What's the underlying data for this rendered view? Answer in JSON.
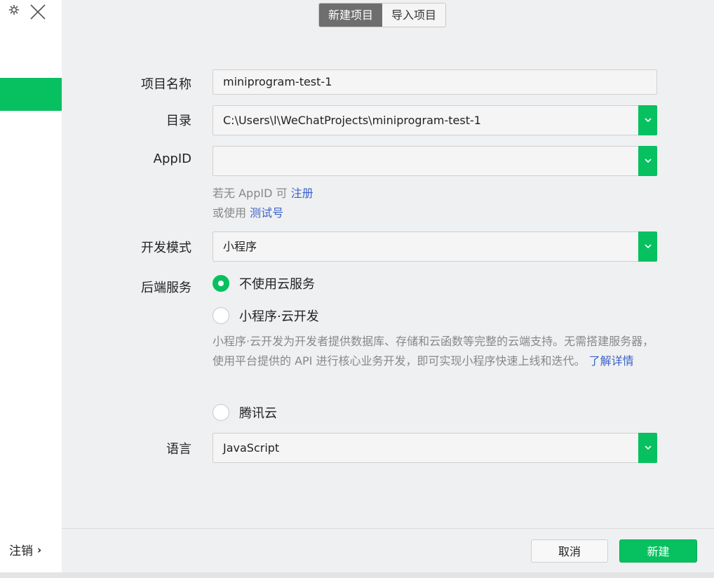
{
  "sidebar": {
    "logout_label": "注销",
    "logout_chevron": "›"
  },
  "tabs": [
    {
      "label": "新建项目",
      "active": true
    },
    {
      "label": "导入项目",
      "active": false
    }
  ],
  "form": {
    "project_name": {
      "label": "项目名称",
      "value": "miniprogram-test-1"
    },
    "directory": {
      "label": "目录",
      "value": "C:\\Users\\l\\WeChatProjects\\miniprogram-test-1"
    },
    "appid": {
      "label": "AppID",
      "value": ""
    },
    "appid_hint": {
      "line1_prefix": "若无 AppID 可 ",
      "line1_link": "注册",
      "line2_prefix": "或使用 ",
      "line2_link": "测试号"
    },
    "dev_mode": {
      "label": "开发模式",
      "value": "小程序"
    },
    "backend": {
      "label": "后端服务",
      "options": [
        {
          "label": "不使用云服务",
          "checked": true
        },
        {
          "label": "小程序·云开发",
          "checked": false
        },
        {
          "label": "腾讯云",
          "checked": false
        }
      ],
      "cloud_desc": "小程序·云开发为开发者提供数据库、存储和云函数等完整的云端支持。无需搭建服务器，使用平台提供的 API 进行核心业务开发，即可实现小程序快速上线和迭代。",
      "learn_more": "了解详情"
    },
    "language": {
      "label": "语言",
      "value": "JavaScript"
    }
  },
  "footer": {
    "cancel_label": "取消",
    "create_label": "新建"
  },
  "colors": {
    "accent": "#07c160",
    "link": "#3a62c9",
    "tab_active": "#6e6e6e"
  }
}
